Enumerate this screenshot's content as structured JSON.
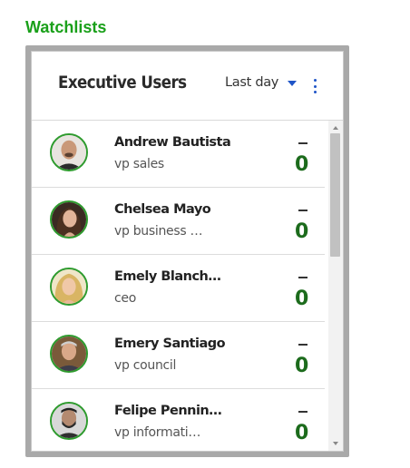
{
  "section_title": "Watchlists",
  "widget": {
    "title": "Executive Users",
    "range_label": "Last day",
    "accent_color": "#1f55c7",
    "count_color": "#1c6b1c"
  },
  "users": [
    {
      "name": "Andrew Bautista",
      "role": "vp sales",
      "trend": "—",
      "count": "0",
      "avatar": "bald-man-avatar"
    },
    {
      "name": "Chelsea Mayo",
      "role": "vp business …",
      "trend": "—",
      "count": "0",
      "avatar": "brunette-woman-avatar"
    },
    {
      "name": "Emely Blanch…",
      "role": "ceo",
      "trend": "—",
      "count": "0",
      "avatar": "blonde-woman-avatar"
    },
    {
      "name": "Emery Santiago",
      "role": "vp council",
      "trend": "—",
      "count": "0",
      "avatar": "older-man-avatar"
    },
    {
      "name": "Felipe Pennin…",
      "role": "vp informati…",
      "trend": "—",
      "count": "0",
      "avatar": "bearded-man-avatar"
    }
  ]
}
